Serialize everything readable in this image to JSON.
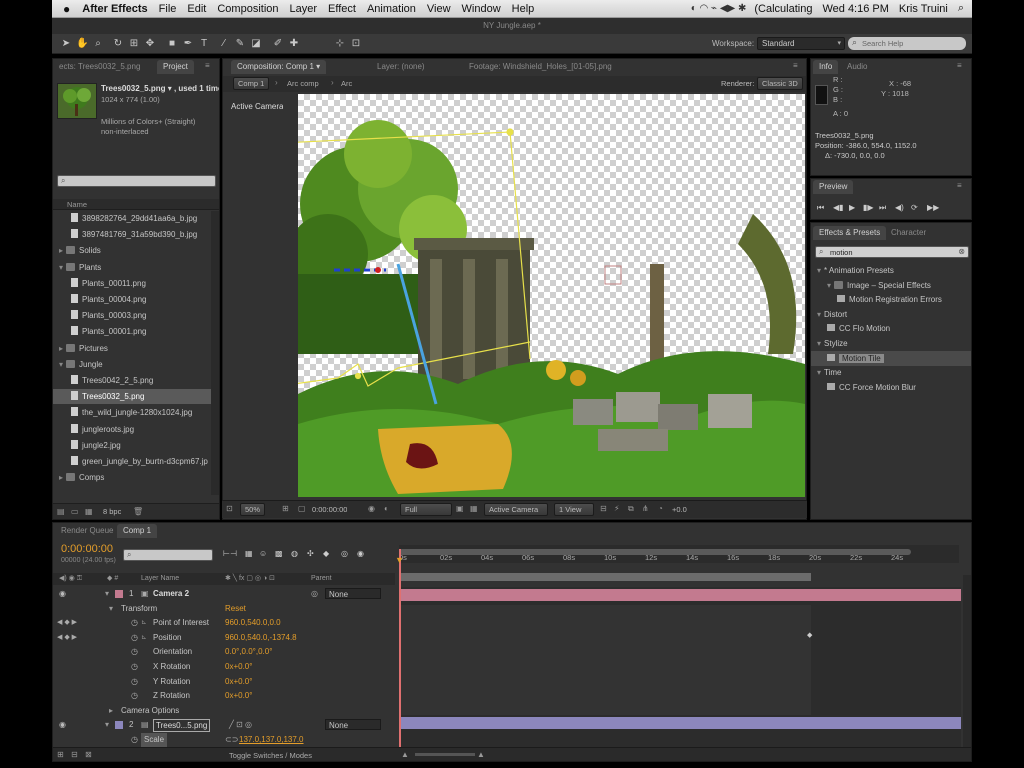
{
  "menubar": {
    "app": "After Effects",
    "items": [
      "File",
      "Edit",
      "Composition",
      "Layer",
      "Effect",
      "Animation",
      "View",
      "Window",
      "Help"
    ],
    "status": "(Calculating",
    "clock": "Wed 4:16 PM",
    "user": "Kris Truini"
  },
  "window": {
    "title": "NY Jungle.aep *"
  },
  "toolbar": {
    "workspace_label": "Workspace:",
    "workspace_value": "Standard",
    "search_placeholder": "Search Help"
  },
  "project": {
    "tabs": [
      "ects: Trees0032_5.png",
      "Project"
    ],
    "selected_name": "Trees0032_5.png ▾ , used 1 time",
    "dimensions": "1024 x 774 (1.00)",
    "colors": "Millions of Colors+ (Straight)",
    "interlace": "non-interlaced",
    "search_value": "",
    "column_name": "Name",
    "items": [
      {
        "type": "file",
        "label": "3898282764_29dd41aa6a_b.jpg",
        "indent": 2
      },
      {
        "type": "file",
        "label": "3897481769_31a59bd390_b.jpg",
        "indent": 2
      },
      {
        "type": "folder",
        "label": "Solids",
        "indent": 0
      },
      {
        "type": "folder",
        "label": "Plants",
        "indent": 0,
        "open": true
      },
      {
        "type": "file",
        "label": "Plants_00011.png",
        "indent": 2
      },
      {
        "type": "file",
        "label": "Plants_00004.png",
        "indent": 2
      },
      {
        "type": "file",
        "label": "Plants_00003.png",
        "indent": 2
      },
      {
        "type": "file",
        "label": "Plants_00001.png",
        "indent": 2
      },
      {
        "type": "folder",
        "label": "Pictures",
        "indent": 0
      },
      {
        "type": "folder",
        "label": "Jungle",
        "indent": 0,
        "open": true
      },
      {
        "type": "file",
        "label": "Trees0042_2_5.png",
        "indent": 2
      },
      {
        "type": "file",
        "label": "Trees0032_5.png",
        "indent": 2,
        "selected": true
      },
      {
        "type": "file",
        "label": "the_wild_jungle-1280x1024.jpg",
        "indent": 2
      },
      {
        "type": "file",
        "label": "jungleroots.jpg",
        "indent": 2
      },
      {
        "type": "file",
        "label": "jungle2.jpg",
        "indent": 2
      },
      {
        "type": "file",
        "label": "green_jungle_by_burtn-d3cpm67.jp",
        "indent": 2
      },
      {
        "type": "folder",
        "label": "Comps",
        "indent": 0
      }
    ],
    "bpc": "8 bpc"
  },
  "composition": {
    "tabs": [
      "Composition: Comp 1 ▾",
      "Layer: (none)",
      "Footage: Windshield_Holes_[01-05].png"
    ],
    "breadcrumbs": [
      "Comp 1",
      "Arc comp",
      "Arc"
    ],
    "renderer_label": "Renderer:",
    "renderer_value": "Classic 3D",
    "view_label": "Active Camera",
    "footer": {
      "zoom": "50%",
      "timecode": "0:00:00:00",
      "resolution": "Full",
      "camera": "Active Camera",
      "views": "1 View",
      "exposure": "+0.0"
    }
  },
  "info": {
    "tabs": [
      "Info",
      "Audio"
    ],
    "rgba": [
      "R :",
      "G :",
      "B :",
      "A : 0"
    ],
    "x": "X : -68",
    "y": "Y : 1018",
    "layer": "Trees0032_5.png",
    "position": "Position: -386.0, 554.0, 1152.0",
    "delta": "Δ: -730.0, 0.0, 0.0"
  },
  "preview": {
    "tab": "Preview"
  },
  "effects": {
    "tabs": [
      "Effects & Presets",
      "Character"
    ],
    "search_value": "motion",
    "items": [
      {
        "label": "* Animation Presets",
        "indent": 0,
        "kind": "header"
      },
      {
        "label": "Image – Special Effects",
        "indent": 1,
        "kind": "folder"
      },
      {
        "label": "Motion Registration Errors",
        "indent": 2,
        "kind": "preset"
      },
      {
        "label": "Distort",
        "indent": 0,
        "kind": "header"
      },
      {
        "label": "CC Flo Motion",
        "indent": 1,
        "kind": "effect"
      },
      {
        "label": "Stylize",
        "indent": 0,
        "kind": "header"
      },
      {
        "label": "Motion Tile",
        "indent": 1,
        "kind": "effect",
        "selected": true
      },
      {
        "label": "Time",
        "indent": 0,
        "kind": "header"
      },
      {
        "label": "CC Force Motion Blur",
        "indent": 1,
        "kind": "effect"
      }
    ]
  },
  "timeline": {
    "tabs": [
      "Render Queue",
      "Comp 1"
    ],
    "timecode": "0:00:00:00",
    "fps": "00000 (24.00 fps)",
    "search_value": "",
    "col_layer_name": "Layer Name",
    "col_parent": "Parent",
    "ruler": [
      "0s",
      "02s",
      "04s",
      "06s",
      "08s",
      "10s",
      "12s",
      "14s",
      "16s",
      "18s",
      "20s",
      "22s",
      "24s"
    ],
    "layers": [
      {
        "num": "1",
        "name": "Camera 2",
        "parent": "None"
      },
      {
        "num": "2",
        "name": "Trees0...5.png",
        "parent": "None"
      }
    ],
    "transform_label": "Transform",
    "reset_label": "Reset",
    "properties": [
      {
        "name": "Point of Interest",
        "value": "960.0,540.0,0.0"
      },
      {
        "name": "Position",
        "value": "960.0,540.0,-1374.8"
      },
      {
        "name": "Orientation",
        "value": "0.0°,0.0°,0.0°"
      },
      {
        "name": "X Rotation",
        "value": "0x+0.0°"
      },
      {
        "name": "Y Rotation",
        "value": "0x+0.0°"
      },
      {
        "name": "Z Rotation",
        "value": "0x+0.0°"
      }
    ],
    "camera_options": "Camera Options",
    "scale_label": "Scale",
    "scale_value": "137.0,137.0,137.0",
    "footer_label": "Toggle Switches / Modes"
  }
}
